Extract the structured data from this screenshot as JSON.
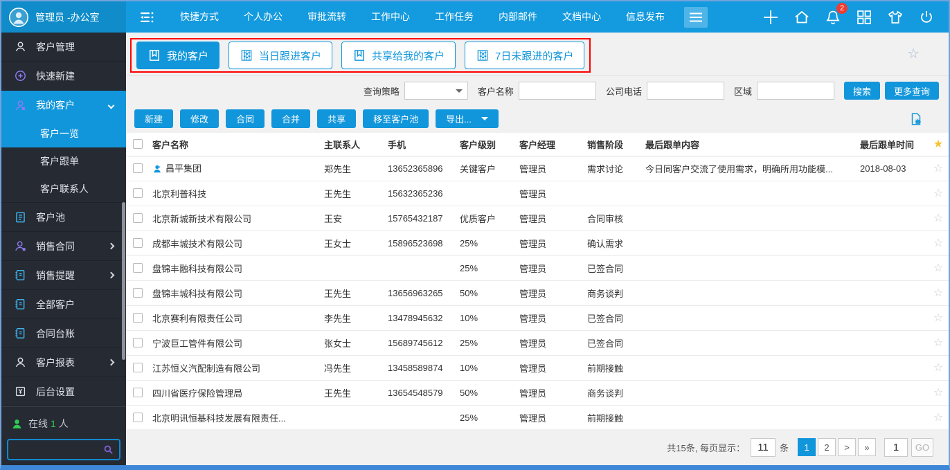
{
  "icons": {
    "star_filled": "★",
    "star_outline": "☆"
  },
  "topbar": {
    "user_name": "管理员 -办公室",
    "nav": [
      "快捷方式",
      "个人办公",
      "审批流转",
      "工作中心",
      "工作任务",
      "内部邮件",
      "文档中心",
      "信息发布"
    ],
    "notification_count": "2"
  },
  "sidebar": {
    "items": [
      {
        "label": "客户管理"
      },
      {
        "label": "快速新建"
      },
      {
        "label": "我的客户"
      },
      {
        "label": "客户一览"
      },
      {
        "label": "客户跟单"
      },
      {
        "label": "客户联系人"
      },
      {
        "label": "客户池"
      },
      {
        "label": "销售合同"
      },
      {
        "label": "销售提醒"
      },
      {
        "label": "全部客户"
      },
      {
        "label": "合同台账"
      },
      {
        "label": "客户报表"
      },
      {
        "label": "后台设置"
      }
    ],
    "online_label": "在线",
    "online_count": "1",
    "online_unit": "人",
    "search_value": ""
  },
  "tabs": [
    {
      "label": "我的客户",
      "active": true
    },
    {
      "label": "当日跟进客户",
      "active": false
    },
    {
      "label": "共享给我的客户",
      "active": false
    },
    {
      "label": "7日未跟进的客户",
      "active": false
    }
  ],
  "filters": {
    "strategy_label": "查询策略",
    "strategy_value": "",
    "customer_name_label": "客户名称",
    "customer_name_value": "",
    "company_phone_label": "公司电话",
    "company_phone_value": "",
    "region_label": "区域",
    "region_value": "",
    "search_button": "搜索",
    "more_button": "更多查询"
  },
  "toolbar": {
    "new": "新建",
    "edit": "修改",
    "contract": "合同",
    "merge": "合并",
    "share": "共享",
    "move_to_pool": "移至客户池",
    "export": "导出..."
  },
  "table": {
    "columns": [
      "客户名称",
      "主联系人",
      "手机",
      "客户级别",
      "客户经理",
      "销售阶段",
      "最后跟单内容",
      "最后跟单时间"
    ],
    "rows": [
      {
        "vip": true,
        "name": "昌平集团",
        "contact": "郑先生",
        "mobile": "13652365896",
        "level": "关键客户",
        "manager": "管理员",
        "stage": "需求讨论",
        "note": "今日同客户交流了使用需求，明确所用功能模...",
        "time": "2018-08-03"
      },
      {
        "vip": false,
        "name": "北京利普科技",
        "contact": "王先生",
        "mobile": "15632365236",
        "level": "",
        "manager": "管理员",
        "stage": "",
        "note": "",
        "time": ""
      },
      {
        "vip": false,
        "name": "北京新城新技术有限公司",
        "contact": "王安",
        "mobile": "15765432187",
        "level": "优质客户",
        "manager": "管理员",
        "stage": "合同审核",
        "note": "",
        "time": ""
      },
      {
        "vip": false,
        "name": "成都丰城技术有限公司",
        "contact": "王女士",
        "mobile": "15896523698",
        "level": "25%",
        "manager": "管理员",
        "stage": "确认需求",
        "note": "",
        "time": ""
      },
      {
        "vip": false,
        "name": "盘锦丰融科技有限公司",
        "contact": "",
        "mobile": "",
        "level": "25%",
        "manager": "管理员",
        "stage": "已签合同",
        "note": "",
        "time": ""
      },
      {
        "vip": false,
        "name": "盘锦丰城科技有限公司",
        "contact": "王先生",
        "mobile": "13656963265",
        "level": "50%",
        "manager": "管理员",
        "stage": "商务谈判",
        "note": "",
        "time": ""
      },
      {
        "vip": false,
        "name": "北京赛利有限责任公司",
        "contact": "李先生",
        "mobile": "13478945632",
        "level": "10%",
        "manager": "管理员",
        "stage": "已签合同",
        "note": "",
        "time": ""
      },
      {
        "vip": false,
        "name": "宁波巨工管件有限公司",
        "contact": "张女士",
        "mobile": "15689745612",
        "level": "25%",
        "manager": "管理员",
        "stage": "已签合同",
        "note": "",
        "time": ""
      },
      {
        "vip": false,
        "name": "江苏恒义汽配制造有限公司",
        "contact": "冯先生",
        "mobile": "13458589874",
        "level": "10%",
        "manager": "管理员",
        "stage": "前期接触",
        "note": "",
        "time": ""
      },
      {
        "vip": false,
        "name": "四川省医疗保险管理局",
        "contact": "王先生",
        "mobile": "13654548579",
        "level": "50%",
        "manager": "管理员",
        "stage": "商务谈判",
        "note": "",
        "time": ""
      },
      {
        "vip": false,
        "name": "北京明讯恒基科技发展有限责任...",
        "contact": "",
        "mobile": "",
        "level": "25%",
        "manager": "管理员",
        "stage": "前期接触",
        "note": "",
        "time": ""
      }
    ]
  },
  "pagination": {
    "summary": "共15条, 每页显示：",
    "page_size": "11",
    "unit": "条",
    "pages": [
      "1",
      "2",
      ">",
      "»"
    ],
    "goto_value": "1",
    "go_label": "GO"
  },
  "colors": {
    "accent": "#1296db",
    "sidebar_bg": "#262a33",
    "annotation": "#ff0000",
    "badge": "#f03b30",
    "star_gold": "#f6c331",
    "online_green": "#2ecc52"
  }
}
